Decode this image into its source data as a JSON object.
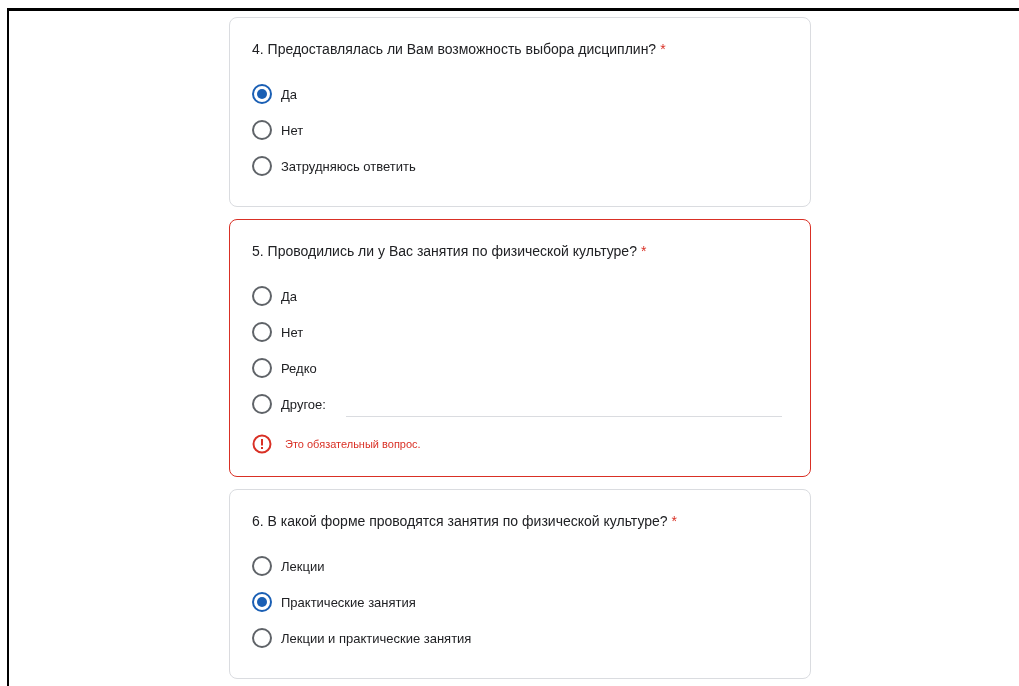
{
  "questions": [
    {
      "title": "4. Предоставлялась ли Вам возможность выбора дисциплин?",
      "required_mark": "*",
      "options": [
        {
          "kind": "radio",
          "label": "Да",
          "selected": true
        },
        {
          "kind": "radio",
          "label": "Нет",
          "selected": false
        },
        {
          "kind": "radio",
          "label": "Затрудняюсь ответить",
          "selected": false
        }
      ]
    },
    {
      "title": "5. Проводились ли у Вас занятия по физической культуре?",
      "required_mark": "*",
      "options": [
        {
          "kind": "radio",
          "label": "Да",
          "selected": false
        },
        {
          "kind": "radio",
          "label": "Нет",
          "selected": false
        },
        {
          "kind": "radio",
          "label": "Редко",
          "selected": false
        },
        {
          "kind": "other",
          "label": "Другое:",
          "selected": false
        }
      ],
      "error": "Это обязательный вопрос."
    },
    {
      "title": "6. В какой форме проводятся занятия по физической культуре?",
      "required_mark": "*",
      "options": [
        {
          "kind": "radio",
          "label": "Лекции",
          "selected": false
        },
        {
          "kind": "radio",
          "label": "Практические занятия",
          "selected": true
        },
        {
          "kind": "radio",
          "label": "Лекции и практические занятия",
          "selected": false
        }
      ]
    }
  ]
}
